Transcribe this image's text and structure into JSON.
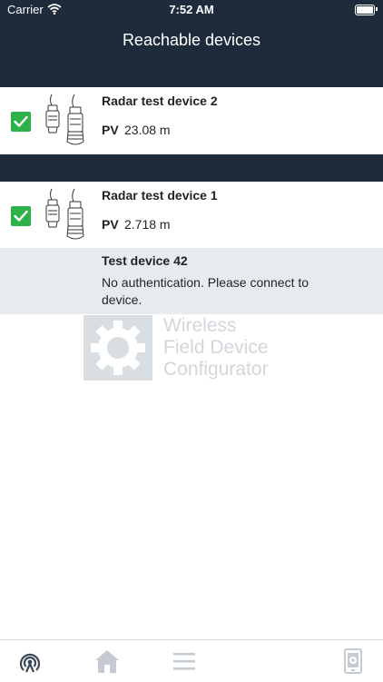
{
  "status_bar": {
    "carrier": "Carrier",
    "time": "7:52 AM"
  },
  "nav": {
    "title": "Reachable devices"
  },
  "devices": [
    {
      "name": "Radar test device 2",
      "pv_label": "PV",
      "pv_value": "23.08 m",
      "checked": true
    },
    {
      "name": "Radar test device 1",
      "pv_label": "PV",
      "pv_value": "2.718 m",
      "checked": true
    }
  ],
  "auth_device": {
    "name": "Test device 42",
    "message": "No authentication. Please connect to device."
  },
  "watermark": {
    "line1": "Wireless",
    "line2": "Field Device",
    "line3": "Configurator"
  },
  "tabs": [
    {
      "icon": "reachable-devices-icon",
      "active": true
    },
    {
      "icon": "home-icon",
      "active": false
    },
    {
      "icon": "menu-icon",
      "active": false
    },
    {
      "icon": "device-icon",
      "active": false
    }
  ],
  "colors": {
    "header": "#1e2b3b",
    "checkbox": "#2db24a",
    "auth_row_bg": "#e7ebef",
    "tab_active": "#3b4756",
    "tab_inactive": "#c5cbd2"
  }
}
